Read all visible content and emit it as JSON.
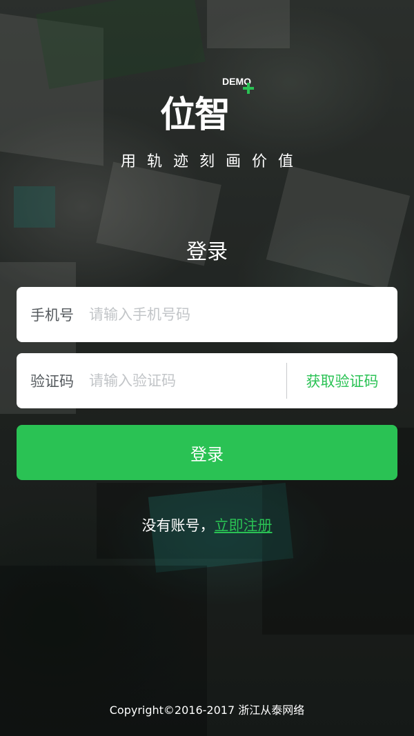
{
  "brand": {
    "logo_text": "位智",
    "demo_tag": "DEMO",
    "slogan": "用轨迹刻画价值",
    "accent_color": "#2ac254"
  },
  "login": {
    "title": "登录",
    "phone": {
      "label": "手机号",
      "placeholder": "请输入手机号码",
      "value": ""
    },
    "code": {
      "label": "验证码",
      "placeholder": "请输入验证码",
      "value": "",
      "get_code_label": "获取验证码"
    },
    "submit_label": "登录",
    "register_prompt": "没有账号，",
    "register_link": "立即注册"
  },
  "footer": {
    "copyright": "Copyright©2016-2017  浙江从泰网络"
  }
}
